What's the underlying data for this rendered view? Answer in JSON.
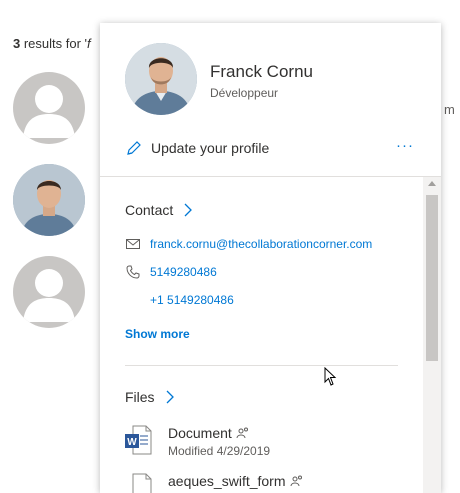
{
  "results": {
    "count": "3",
    "text": " results for '",
    "query_fragment": "f",
    "truncated_right": "m"
  },
  "profile": {
    "name": "Franck Cornu",
    "title": "Développeur",
    "update_label": "Update your profile",
    "more_label": "···"
  },
  "contact": {
    "heading": "Contact",
    "email": "franck.cornu@thecollaborationcorner.com",
    "phone": "5149280486",
    "phone2": "+1 5149280486",
    "show_more": "Show more"
  },
  "files": {
    "heading": "Files",
    "items": [
      {
        "name": "Document",
        "modified": "Modified 4/29/2019"
      },
      {
        "name": "aeques_swift_form",
        "modified": ""
      }
    ]
  },
  "colors": {
    "accent": "#0078d4",
    "word_blue": "#2b579a"
  }
}
